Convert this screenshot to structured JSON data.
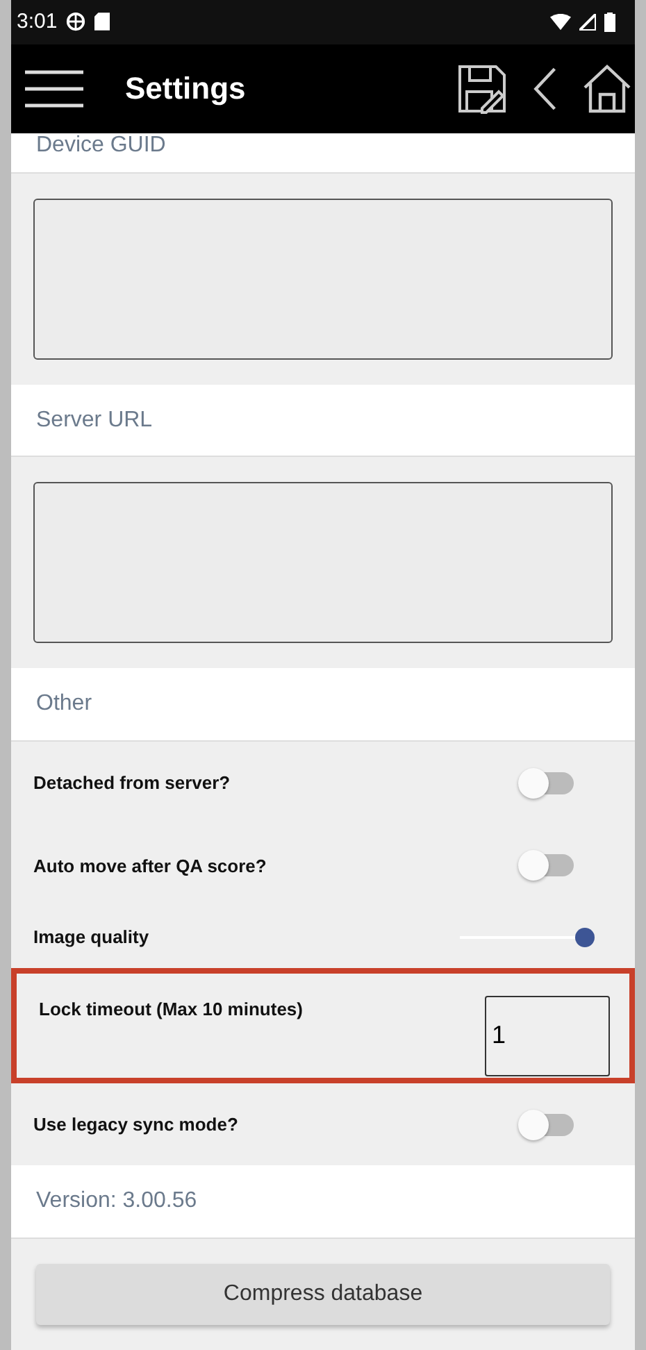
{
  "status_bar": {
    "time": "3:01"
  },
  "app_bar": {
    "title": "Settings"
  },
  "sections": [
    {
      "header": "Device GUID",
      "kind": "textarea"
    },
    {
      "header": "Server URL",
      "kind": "textarea"
    },
    {
      "header": "Other",
      "kind": "settings"
    }
  ],
  "settings": [
    {
      "kind": "toggle",
      "label": "Detached from server?",
      "on": false,
      "highlighted": false
    },
    {
      "kind": "toggle",
      "label": "Auto move after QA score?",
      "on": false,
      "highlighted": false
    },
    {
      "kind": "slider",
      "label": "Image quality",
      "level": 1.0,
      "highlighted": false
    },
    {
      "kind": "number",
      "label": "Lock timeout (Max 10 minutes)",
      "value": "1",
      "highlighted": true
    },
    {
      "kind": "toggle",
      "label": "Use legacy sync mode?",
      "on": false,
      "highlighted": false
    }
  ],
  "version": "Version: 3.00.56",
  "compress_button": "Compress database"
}
